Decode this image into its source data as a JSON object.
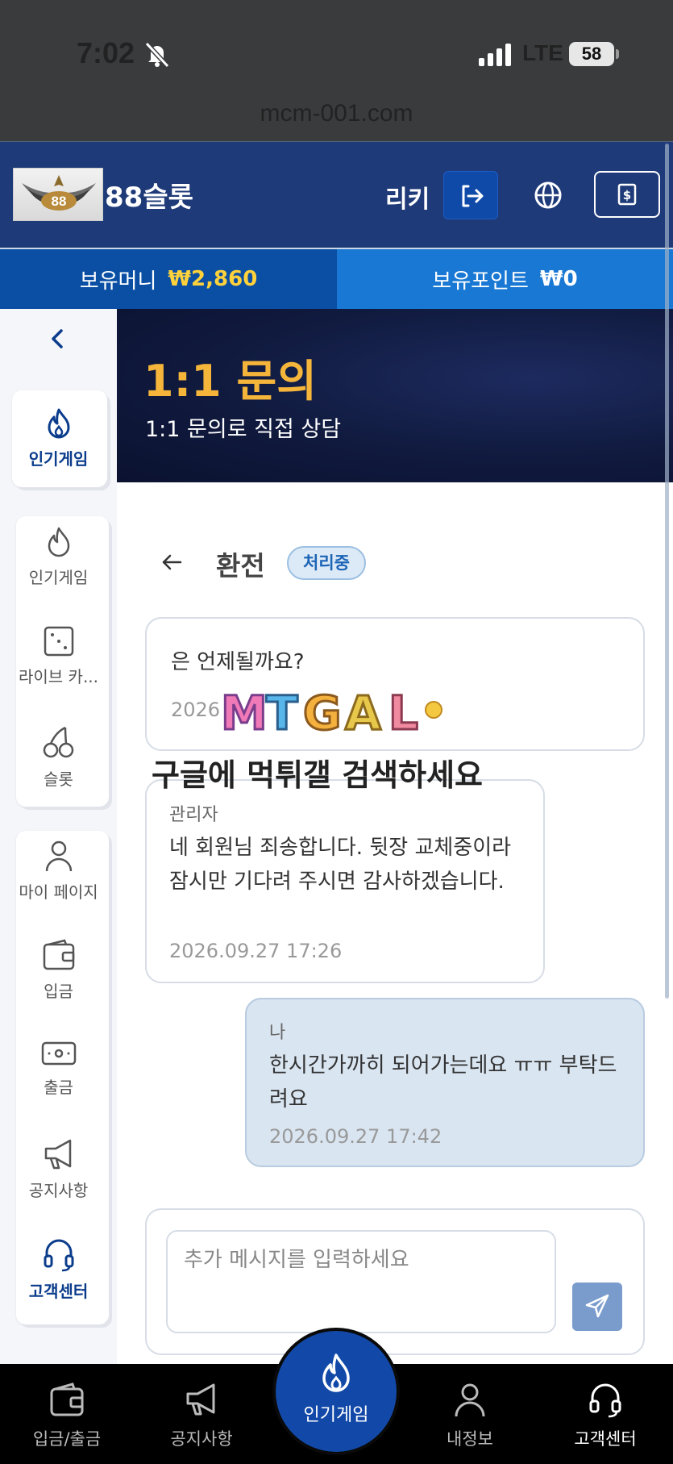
{
  "status_bar": {
    "time": "7:02",
    "network": "LTE",
    "battery": "58"
  },
  "browser": {
    "url": "mcm-001.com"
  },
  "header": {
    "brand": "88슬롯",
    "username": "리키",
    "icons": [
      "logout-icon",
      "globe-icon",
      "money-icon"
    ]
  },
  "balance": {
    "money_label": "보유머니",
    "money_value": "₩2,860",
    "point_label": "보유포인트",
    "point_value": "₩0"
  },
  "sidebar": {
    "active": {
      "label": "인기게임",
      "icon": "fire-icon"
    },
    "group1": [
      {
        "label": "인기게임",
        "icon": "fire-icon"
      },
      {
        "label": "라이브 카...",
        "icon": "dice-icon"
      },
      {
        "label": "슬롯",
        "icon": "cherry-icon"
      }
    ],
    "group2": [
      {
        "label": "마이 페이지",
        "icon": "user-icon"
      },
      {
        "label": "입금",
        "icon": "wallet-icon"
      },
      {
        "label": "출금",
        "icon": "cash-icon"
      },
      {
        "label": "공지사항",
        "icon": "megaphone-icon"
      },
      {
        "label": "고객센터",
        "icon": "headset-icon"
      }
    ]
  },
  "banner": {
    "title": "1:1 문의",
    "subtitle": "1:1 문의로 직접 상담"
  },
  "thread": {
    "title": "환전",
    "status": "처리중",
    "messages": [
      {
        "author": "",
        "text": "은 언제될까요?",
        "date": "2026"
      },
      {
        "author": "관리자",
        "text": "네 회원님 죄송합니다. 뒷장 교체중이라 잠시만 기다려 주시면 감사하겠습니다.",
        "date": "2026.09.27 17:26"
      },
      {
        "author": "나",
        "text": "한시간가까히 되어가는데요 ㅠㅠ 부탁드려요",
        "date": "2026.09.27 17:42"
      }
    ]
  },
  "watermark": {
    "logo": "MTGAL",
    "text": "구글에 먹튀갤 검색하세요"
  },
  "composer": {
    "placeholder": "추가 메시지를 입력하세요",
    "send_icon": "send-icon"
  },
  "bottom_nav": {
    "items": [
      {
        "label": "입금/출금",
        "icon": "wallet-icon"
      },
      {
        "label": "공지사항",
        "icon": "megaphone-icon"
      },
      {
        "label": "인기게임",
        "icon": "fire-icon"
      },
      {
        "label": "내정보",
        "icon": "user-icon"
      },
      {
        "label": "고객센터",
        "icon": "headset-icon"
      }
    ]
  },
  "colors": {
    "header": "#1e3a78",
    "accent": "#1249a8",
    "gold": "#ffd23b",
    "banner_title": "#f5b53b"
  }
}
